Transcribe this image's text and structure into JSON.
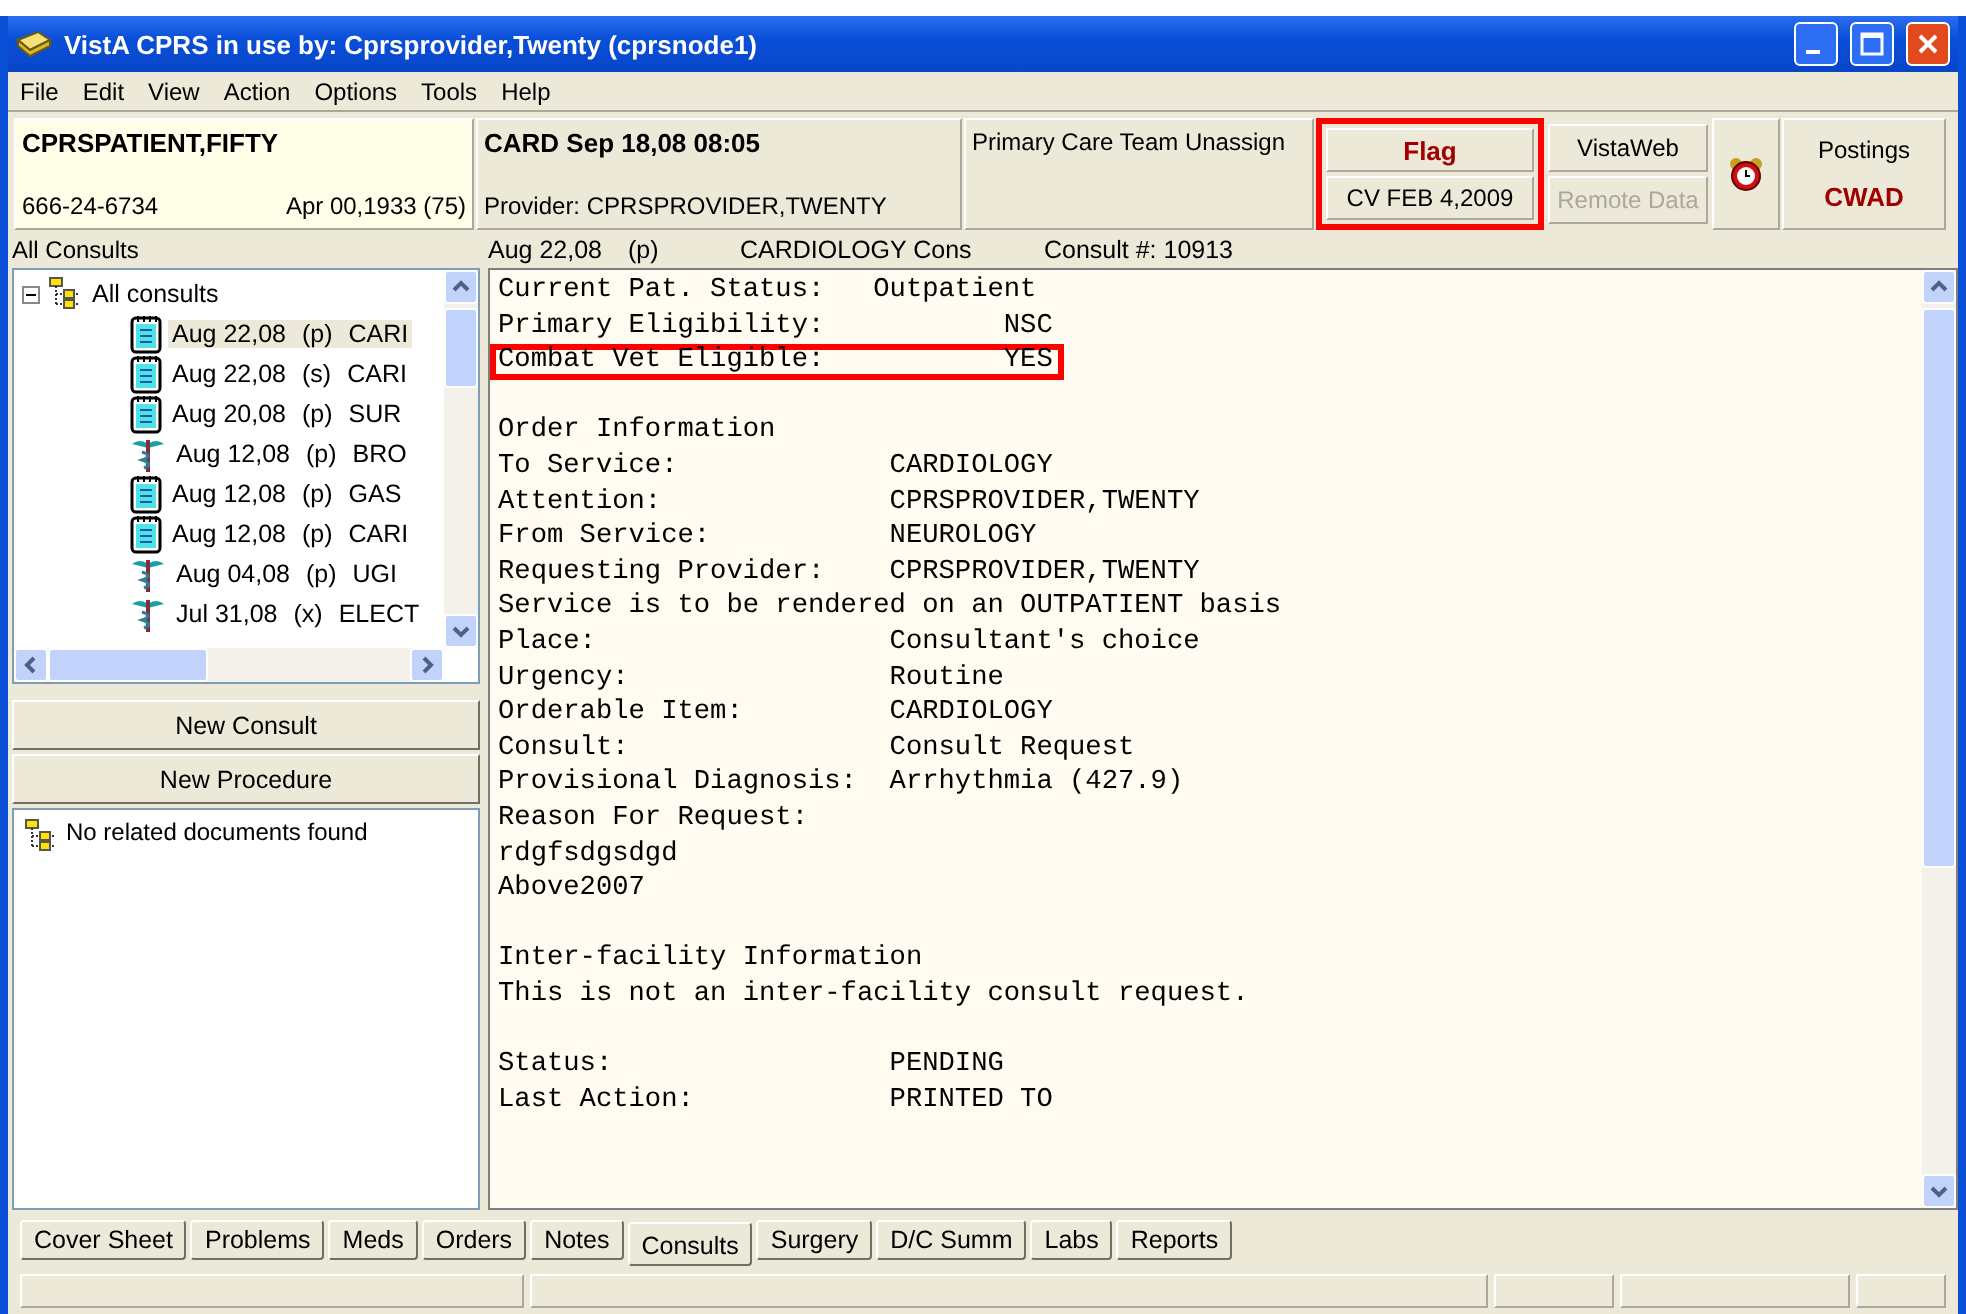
{
  "window": {
    "title": "VistA CPRS in use by: Cprsprovider,Twenty  (cprsnode1)"
  },
  "menu": [
    "File",
    "Edit",
    "View",
    "Action",
    "Options",
    "Tools",
    "Help"
  ],
  "patient": {
    "name": "CPRSPATIENT,FIFTY",
    "ssn": "666-24-6734",
    "dob": "Apr 00,1933 (75)"
  },
  "encounter": {
    "location": "CARD Sep 18,08 08:05",
    "provider": "Provider:  CPRSPROVIDER,TWENTY"
  },
  "care_team": "Primary Care Team Unassign",
  "flag": {
    "label": "Flag",
    "date": "CV FEB 4,2009",
    "highlighted": true
  },
  "vistaweb": {
    "label": "VistaWeb",
    "disabled": false
  },
  "remote_data": {
    "label": "Remote Data",
    "disabled": true
  },
  "postings": {
    "label": "Postings",
    "code": "CWAD"
  },
  "consult_list": {
    "title": "All Consults",
    "root": "All consults",
    "expanded": true,
    "items": [
      {
        "kind": "consult",
        "date": "Aug 22,08",
        "status": "(p)",
        "name": "CARI",
        "selected": true
      },
      {
        "kind": "consult",
        "date": "Aug 22,08",
        "status": "(s)",
        "name": "CARI",
        "selected": false
      },
      {
        "kind": "consult",
        "date": "Aug 20,08",
        "status": "(p)",
        "name": "SUR",
        "selected": false
      },
      {
        "kind": "procedure",
        "date": "Aug 12,08",
        "status": "(p)",
        "name": "BRO",
        "selected": false
      },
      {
        "kind": "consult",
        "date": "Aug 12,08",
        "status": "(p)",
        "name": "GAS",
        "selected": false
      },
      {
        "kind": "consult",
        "date": "Aug 12,08",
        "status": "(p)",
        "name": "CARI",
        "selected": false
      },
      {
        "kind": "procedure",
        "date": "Aug 04,08",
        "status": "(p)",
        "name": "UGI",
        "selected": false
      },
      {
        "kind": "procedure",
        "date": "Jul 31,08",
        "status": "(x)",
        "name": "ELECT",
        "selected": false
      }
    ]
  },
  "buttons": [
    "New Consult",
    "New Procedure"
  ],
  "related_documents": "No related documents found",
  "detail_header": {
    "date": "Aug 22,08",
    "status": "(p)",
    "service": "CARDIOLOGY Cons",
    "number": "Consult #: 10913"
  },
  "detail_lines": [
    {
      "text": "Current Pat. Status:   Outpatient",
      "highlighted": false
    },
    {
      "text": "Primary Eligibility:           NSC",
      "highlighted": false
    },
    {
      "text": "Combat Vet Eligible:           YES",
      "highlighted": true
    },
    {
      "text": "Order Information",
      "highlighted": false,
      "space_before": true
    },
    {
      "text": "To Service:             CARDIOLOGY",
      "highlighted": false
    },
    {
      "text": "Attention:              CPRSPROVIDER,TWENTY",
      "highlighted": false
    },
    {
      "text": "From Service:           NEUROLOGY",
      "highlighted": false
    },
    {
      "text": "Requesting Provider:    CPRSPROVIDER,TWENTY",
      "highlighted": false
    },
    {
      "text": "Service is to be rendered on an OUTPATIENT basis",
      "highlighted": false
    },
    {
      "text": "Place:                  Consultant's choice",
      "highlighted": false
    },
    {
      "text": "Urgency:                Routine",
      "highlighted": false
    },
    {
      "text": "Orderable Item:         CARDIOLOGY",
      "highlighted": false
    },
    {
      "text": "Consult:                Consult Request",
      "highlighted": false
    },
    {
      "text": "Provisional Diagnosis:  Arrhythmia (427.9)",
      "highlighted": false
    },
    {
      "text": "Reason For Request:",
      "highlighted": false
    },
    {
      "text": "rdgfsdgsdgd",
      "highlighted": false
    },
    {
      "text": "Above2007",
      "highlighted": false
    },
    {
      "text": "Inter-facility Information",
      "highlighted": false,
      "space_before": true
    },
    {
      "text": "This is not an inter-facility consult request.",
      "highlighted": false
    },
    {
      "text": "Status:                 PENDING",
      "highlighted": false,
      "space_before": true
    },
    {
      "text": "Last Action:            PRINTED TO",
      "highlighted": false
    }
  ],
  "tabs": [
    {
      "label": "Cover Sheet",
      "selected": false
    },
    {
      "label": "Problems",
      "selected": false
    },
    {
      "label": "Meds",
      "selected": false
    },
    {
      "label": "Orders",
      "selected": false
    },
    {
      "label": "Notes",
      "selected": false
    },
    {
      "label": "Consults",
      "selected": true
    },
    {
      "label": "Surgery",
      "selected": false
    },
    {
      "label": "D/C Summ",
      "selected": false
    },
    {
      "label": "Labs",
      "selected": false
    },
    {
      "label": "Reports",
      "selected": false
    }
  ]
}
